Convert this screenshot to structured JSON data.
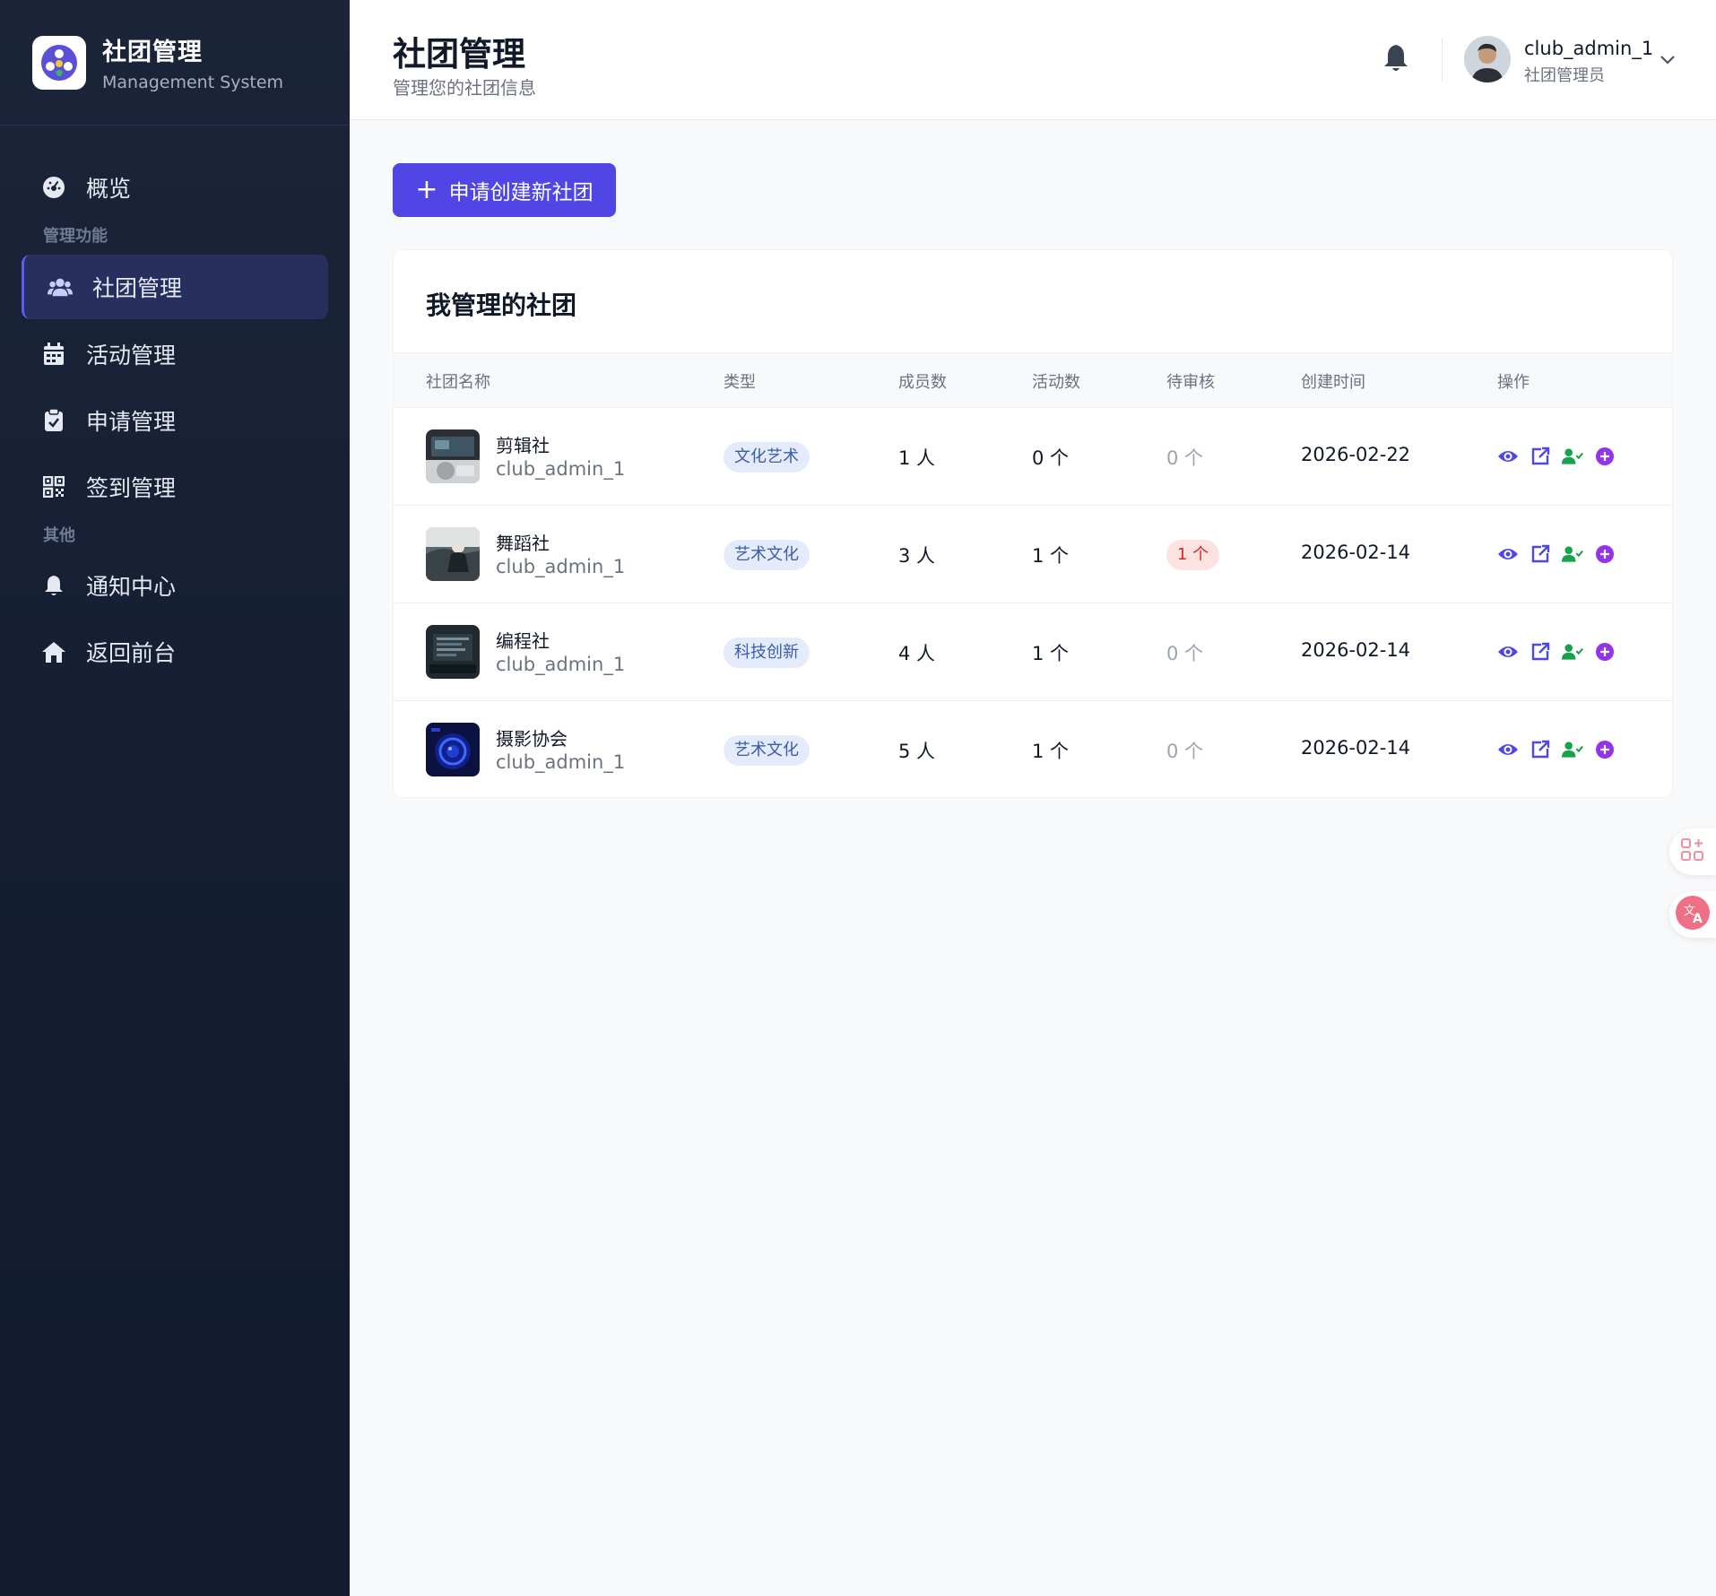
{
  "brand": {
    "title": "社团管理",
    "subtitle": "Management System"
  },
  "nav": {
    "overview": "概览",
    "group_manage": "管理功能",
    "club_manage": "社团管理",
    "activity_manage": "活动管理",
    "application_manage": "申请管理",
    "checkin_manage": "签到管理",
    "group_other": "其他",
    "notifications": "通知中心",
    "back_front": "返回前台"
  },
  "header": {
    "title": "社团管理",
    "subtitle": "管理您的社团信息",
    "username": "club_admin_1",
    "role": "社团管理员"
  },
  "create_button": {
    "label": "申请创建新社团"
  },
  "card": {
    "title": "我管理的社团"
  },
  "table": {
    "headers": [
      "社团名称",
      "类型",
      "成员数",
      "活动数",
      "待审核",
      "创建时间",
      "操作"
    ],
    "rows": [
      {
        "name": "剪辑社",
        "owner": "club_admin_1",
        "type": "文化艺术",
        "members": "1 人",
        "activities": "0 个",
        "pending": "0 个",
        "pending_count": 0,
        "created": "2026-02-22"
      },
      {
        "name": "舞蹈社",
        "owner": "club_admin_1",
        "type": "艺术文化",
        "members": "3 人",
        "activities": "1 个",
        "pending": "1 个",
        "pending_count": 1,
        "created": "2026-02-14"
      },
      {
        "name": "编程社",
        "owner": "club_admin_1",
        "type": "科技创新",
        "members": "4 人",
        "activities": "1 个",
        "pending": "0 个",
        "pending_count": 0,
        "created": "2026-02-14"
      },
      {
        "name": "摄影协会",
        "owner": "club_admin_1",
        "type": "艺术文化",
        "members": "5 人",
        "activities": "1 个",
        "pending": "0 个",
        "pending_count": 0,
        "created": "2026-02-14"
      }
    ]
  },
  "colors": {
    "accent": "#4f46e5",
    "sidebar": "#151e33",
    "success": "#16a34a",
    "purple": "#9333ea",
    "danger": "#dc2626"
  },
  "icons": [
    "dashboard-icon",
    "users-icon",
    "calendar-icon",
    "clipboard-check-icon",
    "qrcode-icon",
    "bell-icon",
    "home-icon",
    "eye-icon",
    "external-link-icon",
    "user-check-icon",
    "plus-circle-icon",
    "chevron-down-icon",
    "apps-icon",
    "translate-icon"
  ]
}
